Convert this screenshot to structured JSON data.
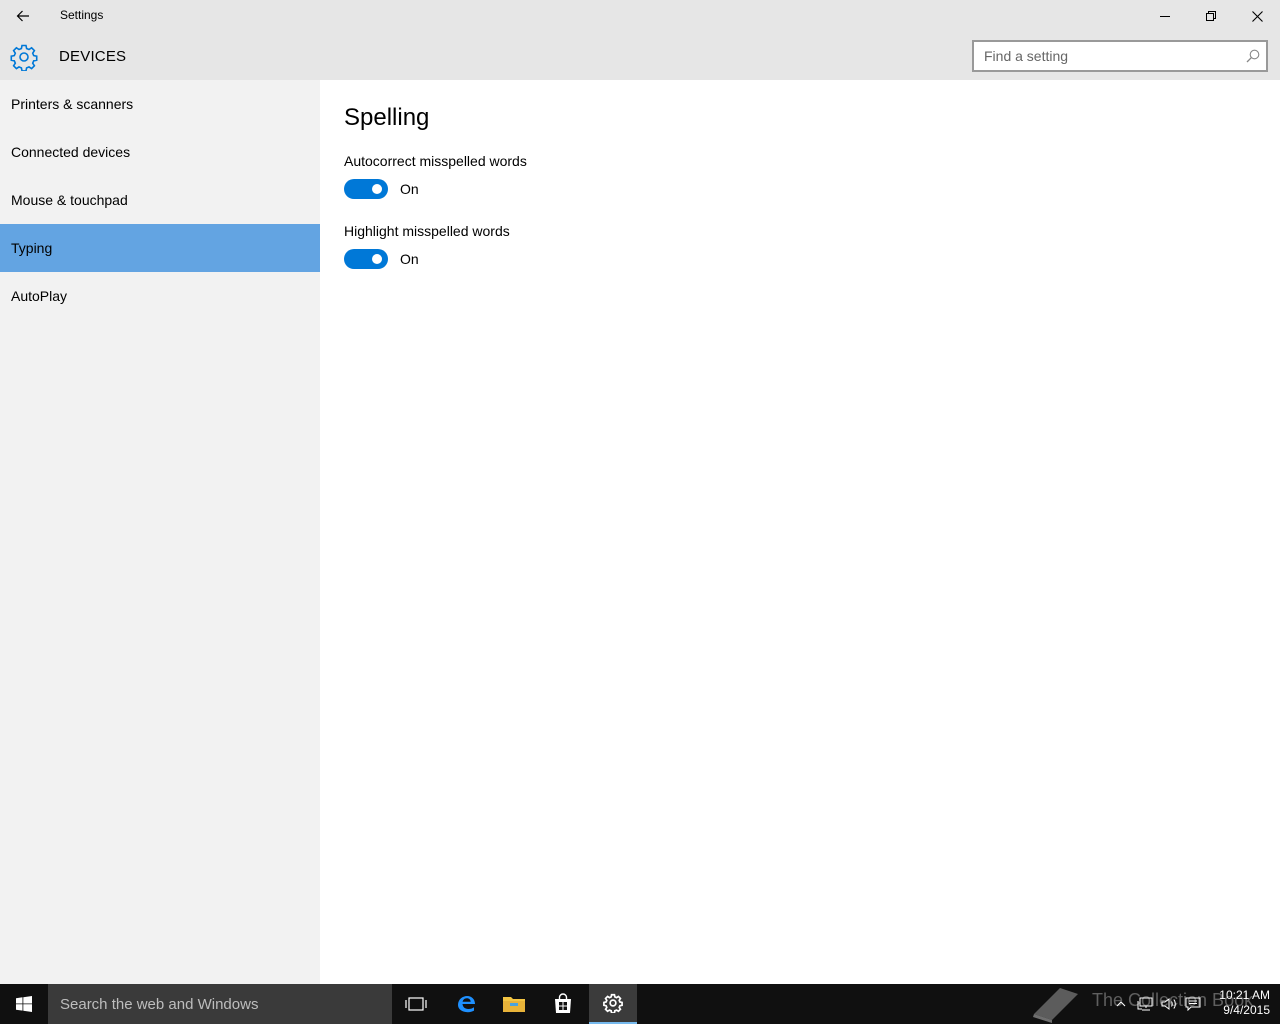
{
  "window": {
    "title": "Settings",
    "back_icon": "back-arrow-icon",
    "minimize_icon": "minimize-icon",
    "maximize_icon": "restore-icon",
    "close_icon": "close-icon"
  },
  "header": {
    "icon": "gear-icon",
    "section": "DEVICES",
    "search_placeholder": "Find a setting",
    "search_value": ""
  },
  "sidebar": {
    "items": [
      {
        "label": "Printers & scanners",
        "selected": false
      },
      {
        "label": "Connected devices",
        "selected": false
      },
      {
        "label": "Mouse & touchpad",
        "selected": false
      },
      {
        "label": "Typing",
        "selected": true
      },
      {
        "label": "AutoPlay",
        "selected": false
      }
    ],
    "selected_color": "#63a4e2"
  },
  "main": {
    "title": "Spelling",
    "settings": [
      {
        "label": "Autocorrect misspelled words",
        "state": "On",
        "enabled": true
      },
      {
        "label": "Highlight misspelled words",
        "state": "On",
        "enabled": true
      }
    ],
    "accent_color": "#0078d7"
  },
  "taskbar": {
    "search_text": "Search the web and Windows",
    "pinned": [
      "task-view-icon",
      "edge-icon",
      "file-explorer-icon",
      "store-icon",
      "settings-icon"
    ],
    "active_app": "settings-icon",
    "tray": [
      "chevron-up-icon",
      "network-icon",
      "volume-icon",
      "action-center-icon"
    ],
    "time": "10:21 AM",
    "date": "9/4/2015",
    "watermark": "The Collection Book"
  }
}
